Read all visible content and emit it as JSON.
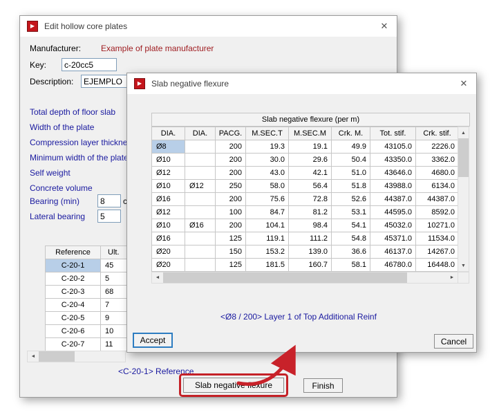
{
  "icons": {
    "app_logo": "▶",
    "close": "✕",
    "up_arrow": "▲",
    "down_arrow": "▼",
    "left_arrow": "◄",
    "right_arrow": "►"
  },
  "back_dialog": {
    "title": "Edit hollow core plates",
    "manufacturer_label": "Manufacturer:",
    "manufacturer_value": "Example of plate manufacturer",
    "key_label": "Key:",
    "key_value": "c-20cc5",
    "description_label": "Description:",
    "description_value": "EJEMPLO",
    "properties": [
      "Total depth of floor slab",
      "Width of the plate",
      "Compression layer thickness",
      "Minimum width of the plate",
      "Self weight",
      "Concrete volume"
    ],
    "bearing_label": "Bearing (min)",
    "bearing_value": "8",
    "bearing_unit": "c",
    "lateral_label": "Lateral bearing",
    "lateral_value": "5",
    "table": {
      "headers": [
        "Reference",
        "Ult."
      ],
      "rows": [
        [
          "C-20-1",
          "45"
        ],
        [
          "C-20-2",
          "5"
        ],
        [
          "C-20-3",
          "68"
        ],
        [
          "C-20-4",
          "7"
        ],
        [
          "C-20-5",
          "9"
        ],
        [
          "C-20-6",
          "10"
        ],
        [
          "C-20-7",
          "11"
        ]
      ],
      "selected_row": 0
    },
    "reference_note": "<C-20-1>  Reference",
    "slab_button_label": "Slab negative flexure",
    "finish_button_label": "Finish"
  },
  "front_dialog": {
    "title": "Slab negative flexure",
    "table": {
      "title": "Slab negative flexure (per m)",
      "columns": [
        "DIA.",
        "DIA.",
        "PACG.",
        "M.SEC.T",
        "M.SEC.M",
        "Crk. M.",
        "Tot. stif.",
        "Crk. stif."
      ],
      "rows": [
        [
          "Ø8",
          "",
          "200",
          "19.3",
          "19.1",
          "49.9",
          "43105.0",
          "2226.0"
        ],
        [
          "Ø10",
          "",
          "200",
          "30.0",
          "29.6",
          "50.4",
          "43350.0",
          "3362.0"
        ],
        [
          "Ø12",
          "",
          "200",
          "43.0",
          "42.1",
          "51.0",
          "43646.0",
          "4680.0"
        ],
        [
          "Ø10",
          "Ø12",
          "250",
          "58.0",
          "56.4",
          "51.8",
          "43988.0",
          "6134.0"
        ],
        [
          "Ø16",
          "",
          "200",
          "75.6",
          "72.8",
          "52.6",
          "44387.0",
          "44387.0"
        ],
        [
          "Ø12",
          "",
          "100",
          "84.7",
          "81.2",
          "53.1",
          "44595.0",
          "8592.0"
        ],
        [
          "Ø10",
          "Ø16",
          "200",
          "104.1",
          "98.4",
          "54.1",
          "45032.0",
          "10271.0"
        ],
        [
          "Ø16",
          "",
          "125",
          "119.1",
          "111.2",
          "54.8",
          "45371.0",
          "11534.0"
        ],
        [
          "Ø20",
          "",
          "150",
          "153.2",
          "139.0",
          "36.6",
          "46137.0",
          "14267.0"
        ],
        [
          "Ø20",
          "",
          "125",
          "181.5",
          "160.7",
          "58.1",
          "46780.0",
          "16448.0"
        ]
      ],
      "selected": {
        "row": 0,
        "col": 0
      }
    },
    "note": "<Ø8 / 200>  Layer 1 of Top Additional Reinf",
    "accept_button_label": "Accept",
    "cancel_button_label": "Cancel"
  },
  "annotation_color": "#c8222a"
}
